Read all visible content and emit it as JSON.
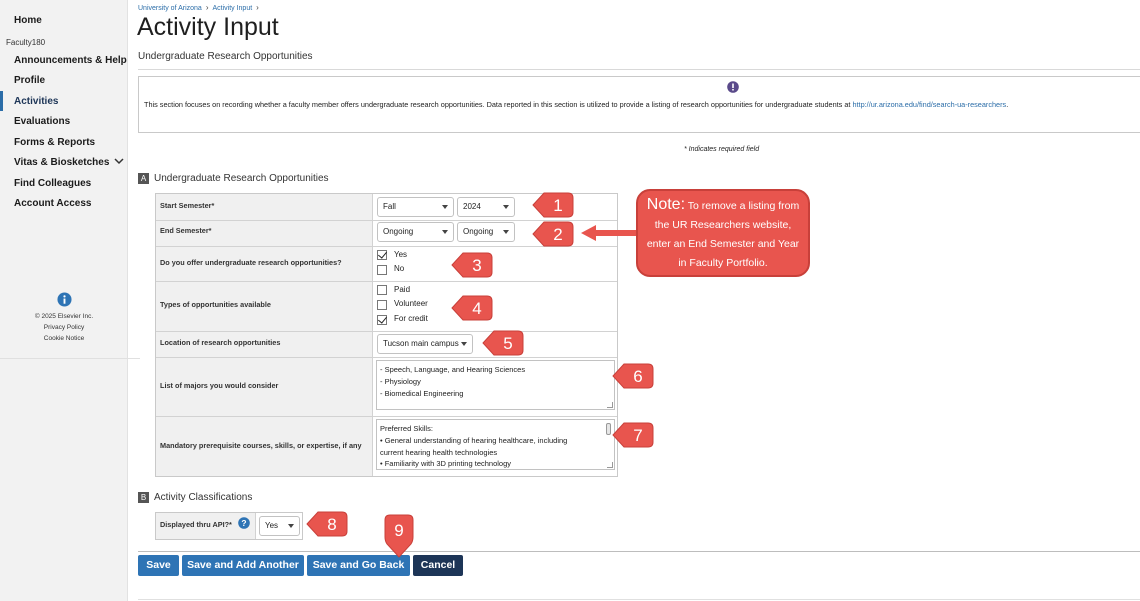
{
  "sidebar": {
    "home": "Home",
    "section": "Faculty180",
    "items": [
      {
        "label": "Announcements & Help"
      },
      {
        "label": "Profile"
      },
      {
        "label": "Activities"
      },
      {
        "label": "Evaluations"
      },
      {
        "label": "Forms & Reports"
      },
      {
        "label": "Vitas & Biosketches"
      },
      {
        "label": "Find Colleagues"
      },
      {
        "label": "Account Access"
      }
    ],
    "footer": {
      "copyright": "© 2025 Elsevier Inc.",
      "privacy": "Privacy Policy",
      "cookie": "Cookie Notice"
    }
  },
  "breadcrumb": [
    "University of Arizona",
    "Activity Input"
  ],
  "page_title": "Activity Input",
  "subtitle": "Undergraduate Research Opportunities",
  "info_text": "This section focuses on recording whether a faculty member offers undergraduate research opportunities.  Data reported in this section is utilized to provide a listing of research opportunities for undergraduate students at ",
  "info_link": "http://ur.arizona.edu/find/search-ua-researchers",
  "info_link_suffix": ".",
  "required_note": "* Indicates required field",
  "section_a": {
    "letter": "A",
    "title": "Undergraduate Research Opportunities"
  },
  "fields": {
    "start_semester": {
      "label": "Start Semester*",
      "term": "Fall",
      "year": "2024"
    },
    "end_semester": {
      "label": "End Semester*",
      "term": "Ongoing",
      "year": "Ongoing"
    },
    "offer": {
      "label": "Do you offer undergraduate research opportunities?",
      "options": [
        {
          "label": "Yes",
          "checked": true
        },
        {
          "label": "No",
          "checked": false
        }
      ]
    },
    "types": {
      "label": "Types of opportunities available",
      "options": [
        {
          "label": "Paid",
          "checked": false
        },
        {
          "label": "Volunteer",
          "checked": false
        },
        {
          "label": "For credit",
          "checked": true
        }
      ]
    },
    "location": {
      "label": "Location of research opportunities",
      "value": "Tucson main campus"
    },
    "majors": {
      "label": "List of majors you would consider",
      "lines": [
        "- Speech, Language, and Hearing Sciences",
        "- Physiology",
        "- Biomedical Engineering"
      ]
    },
    "prereq": {
      "label": "Mandatory prerequisite courses, skills, or expertise, if any",
      "lines": [
        "Preferred Skills:",
        "•     General understanding of hearing healthcare, including",
        "current hearing health technologies",
        "•     Familiarity with 3D printing technology"
      ]
    }
  },
  "section_b": {
    "letter": "B",
    "title": "Activity Classifications"
  },
  "api": {
    "label": "Displayed thru API?*",
    "value": "Yes"
  },
  "buttons": {
    "save": "Save",
    "save_add": "Save and Add Another",
    "save_back": "Save and Go Back",
    "cancel": "Cancel"
  },
  "annotations": {
    "markers": [
      "1",
      "2",
      "3",
      "4",
      "5",
      "6",
      "7",
      "8",
      "9"
    ],
    "note_title": "Note:",
    "note_line1": "To remove a listing from",
    "note_line2": "the UR Researchers website,",
    "note_line3": "enter an End Semester and Year",
    "note_line4": "in Faculty Portfolio."
  },
  "colors": {
    "accent": "#2e74b5",
    "dark_button": "#1d3557",
    "annotation": "#e8554e"
  }
}
